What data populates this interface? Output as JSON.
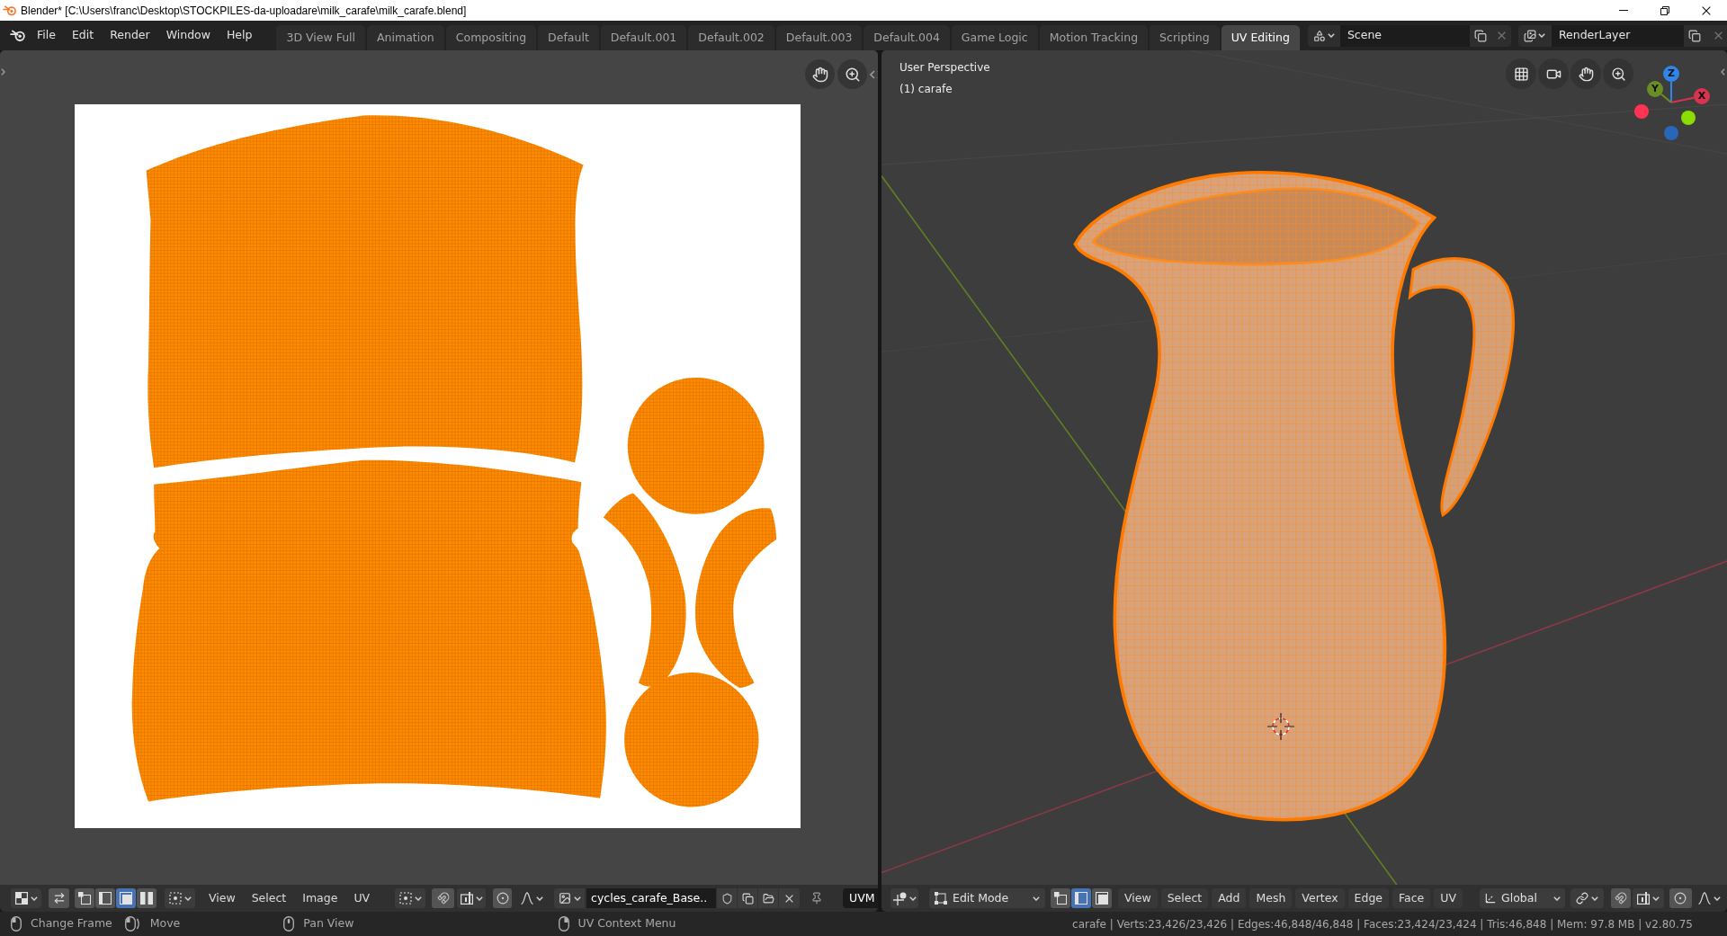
{
  "window": {
    "title": "Blender* [C:\\Users\\franc\\Desktop\\STOCKPILES-da-uploadare\\milk_carafe\\milk_carafe.blend]"
  },
  "top_bar": {
    "menus": [
      "File",
      "Edit",
      "Render",
      "Window",
      "Help"
    ],
    "workspaces": [
      {
        "label": "3D View Full",
        "selected": false
      },
      {
        "label": "Animation",
        "selected": false
      },
      {
        "label": "Compositing",
        "selected": false
      },
      {
        "label": "Default",
        "selected": false
      },
      {
        "label": "Default.001",
        "selected": false
      },
      {
        "label": "Default.002",
        "selected": false
      },
      {
        "label": "Default.003",
        "selected": false
      },
      {
        "label": "Default.004",
        "selected": false
      },
      {
        "label": "Game Logic",
        "selected": false
      },
      {
        "label": "Motion Tracking",
        "selected": false
      },
      {
        "label": "Scripting",
        "selected": false
      },
      {
        "label": "UV Editing",
        "selected": true
      }
    ],
    "scene": {
      "value": "Scene"
    },
    "view_layer": {
      "value": "RenderLayer"
    }
  },
  "uv_editor": {
    "header": {
      "select_modes": [
        {
          "selected": false
        },
        {
          "selected": false
        },
        {
          "selected": true
        },
        {
          "selected": false
        }
      ],
      "menus": [
        "View",
        "Select",
        "Image",
        "UV"
      ],
      "image": {
        "value": "cycles_carafe_Base.."
      },
      "uv_map": {
        "value": "UVM"
      }
    }
  },
  "viewport": {
    "view_name": "User Perspective",
    "object_name": "(1) carafe",
    "gizmo": {
      "axes": [
        {
          "label": "Z",
          "color": "#2f86ea"
        },
        {
          "label": "Y",
          "color": "#6a8e23"
        },
        {
          "label": "X",
          "color": "#d8344f"
        }
      ]
    },
    "header": {
      "mode": "Edit Mode",
      "select_modes": [
        {
          "selected": false
        },
        {
          "selected": true
        },
        {
          "selected": false
        }
      ],
      "menus": [
        "View",
        "Select",
        "Add",
        "Mesh",
        "Vertex",
        "Edge",
        "Face",
        "UV"
      ],
      "orientation": "Global"
    }
  },
  "status_bar": {
    "hints": [
      {
        "label": "Change Frame",
        "kind": "left"
      },
      {
        "label": "Move",
        "kind": "drag"
      },
      {
        "label": "Pan View",
        "kind": "middle"
      },
      {
        "label": "UV Context Menu",
        "kind": "right"
      }
    ],
    "stats": "carafe | Verts:23,426/23,426 | Edges:46,848/46,848 | Faces:23,424/23,424 | Tris:46,848 | Mem: 97.8 MB | v2.80.75"
  }
}
